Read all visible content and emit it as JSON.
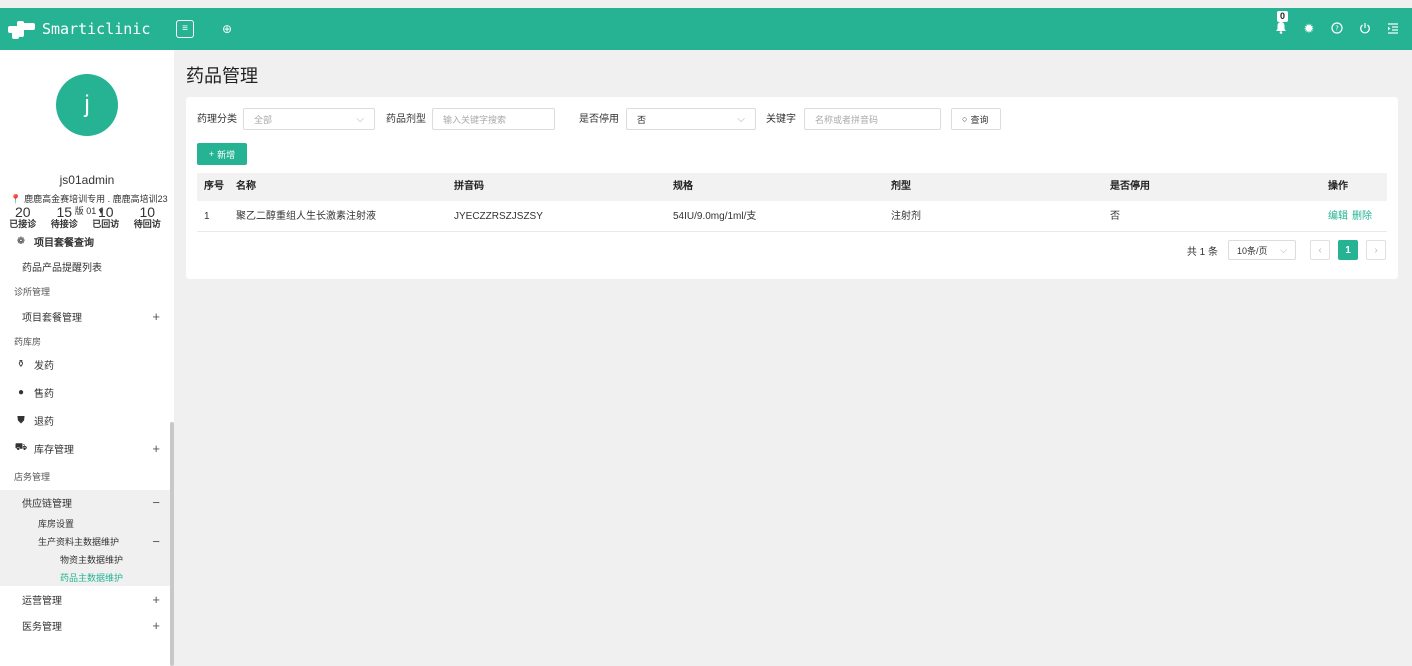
{
  "app": {
    "brand": "Smarticlinic"
  },
  "header": {
    "menu_toggle_glyph": "≡",
    "add_tab_glyph": "⊕",
    "notification_count": "0"
  },
  "sidebar": {
    "avatar_letter": "j",
    "username": "js01admin",
    "clinic": "鹿鹿高金赛培训专用 . 鹿鹿高培训23版 01",
    "stats": [
      {
        "num": "20",
        "label": "已接诊"
      },
      {
        "num": "15",
        "label": "待接诊"
      },
      {
        "num": "10",
        "label": "已回访"
      },
      {
        "num": "10",
        "label": "待回访"
      }
    ],
    "items": {
      "project_package_query": "项目套餐查询",
      "drug_reminder_list": "药品产品提醒列表",
      "section_clinic": "诊所管理",
      "project_package_mgmt": "项目套餐管理",
      "section_pharmacy": "药库房",
      "dispense": "发药",
      "sell": "售药",
      "return": "退药",
      "inventory": "库存管理",
      "section_store": "店务管理",
      "supply_chain": "供应链管理",
      "warehouse_settings": "库房设置",
      "master_data": "生产资料主数据维护",
      "material_master": "物资主数据维护",
      "drug_master": "药品主数据维护",
      "operations": "运营管理",
      "medical_affairs": "医务管理"
    }
  },
  "page": {
    "title": "药品管理"
  },
  "filters": {
    "category_label": "药理分类",
    "category_value": "全部",
    "dosage_label": "药品剂型",
    "dosage_placeholder": "输入关键字搜索",
    "disabled_label": "是否停用",
    "disabled_value": "否",
    "keyword_label": "关键字",
    "keyword_placeholder": "名称或者拼音码",
    "query_button": "查询",
    "add_button": "新增"
  },
  "table": {
    "columns": [
      "序号",
      "名称",
      "拼音码",
      "规格",
      "剂型",
      "是否停用",
      "操作"
    ],
    "rows": [
      {
        "index": "1",
        "name": "聚乙二醇重组人生长激素注射液",
        "pinyin": "JYECZZRSZJSZSY",
        "spec": "54IU/9.0mg/1ml/支",
        "form": "注射剂",
        "disabled": "否",
        "edit": "编辑",
        "delete": "删除"
      }
    ]
  },
  "pagination": {
    "total": "共 1 条",
    "page_size": "10条/页",
    "current_page": "1"
  },
  "colors": {
    "accent": "#25b394"
  }
}
